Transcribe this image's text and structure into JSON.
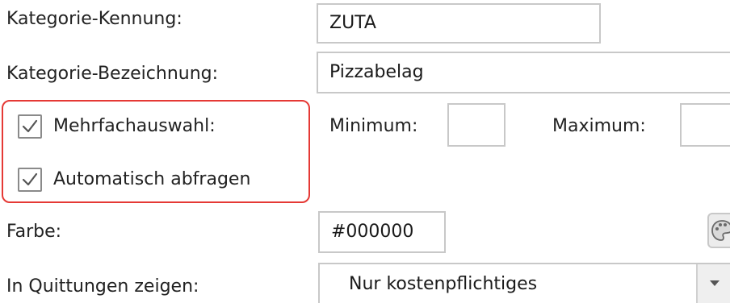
{
  "form": {
    "category_id_label": "Kategorie-Kennung:",
    "category_id_value": "ZUTA",
    "category_name_label": "Kategorie-Bezeichnung:",
    "category_name_value": "Pizzabelag",
    "multi_select_label": "Mehrfachauswahl:",
    "multi_select_checked": true,
    "minimum_label": "Minimum:",
    "minimum_value": "",
    "maximum_label": "Maximum:",
    "maximum_value": "",
    "auto_query_label": "Automatisch abfragen",
    "auto_query_checked": true,
    "color_label": "Farbe:",
    "color_value": "#000000",
    "color_picker_icon": "palette-icon",
    "receipt_label": "In Quittungen zeigen:",
    "receipt_selected": "Nur kostenpflichtiges",
    "dropdown_icon": "chevron-down-icon"
  },
  "colors": {
    "highlight_border": "#e53935",
    "field_border": "#c8c8c8",
    "checkmark": "#555555"
  }
}
